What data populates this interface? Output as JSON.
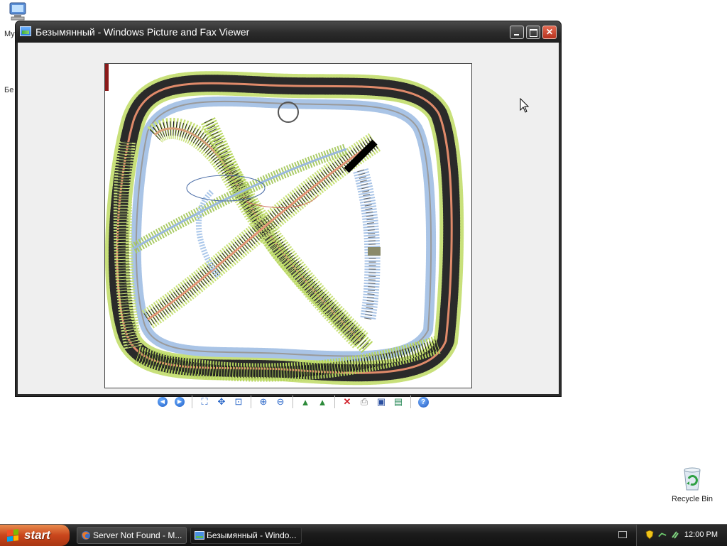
{
  "desktop": {
    "my_computer_label": "My",
    "unnamed_file_label": "Бе",
    "recycle_bin_label": "Recycle Bin"
  },
  "window": {
    "title": "Безымянный - Windows Picture and Fax Viewer",
    "buttons": {
      "minimize": "Minimize",
      "maximize": "Maximize",
      "close": "Close"
    },
    "toolbar": [
      "previous-image-icon",
      "next-image-icon",
      "best-fit-icon",
      "actual-size-icon",
      "slideshow-icon",
      "zoom-in-icon",
      "zoom-out-icon",
      "rotate-clockwise-icon",
      "rotate-counterclockwise-icon",
      "delete-icon",
      "print-icon",
      "save-icon",
      "open-for-editing-icon",
      "help-icon"
    ]
  },
  "taskbar": {
    "start_label": "start",
    "tasks": [
      {
        "label": "Server Not Found - M...",
        "active": false
      },
      {
        "label": "Безымянный - Windo...",
        "active": true
      }
    ],
    "clock": "12:00 PM"
  },
  "colors": {
    "titlebar": "#2b2b2b",
    "start_button": "#c9461c",
    "taskbar": "#1c1c1c",
    "client_background": "#efefef",
    "toolbar_icon": "#2966c8"
  }
}
